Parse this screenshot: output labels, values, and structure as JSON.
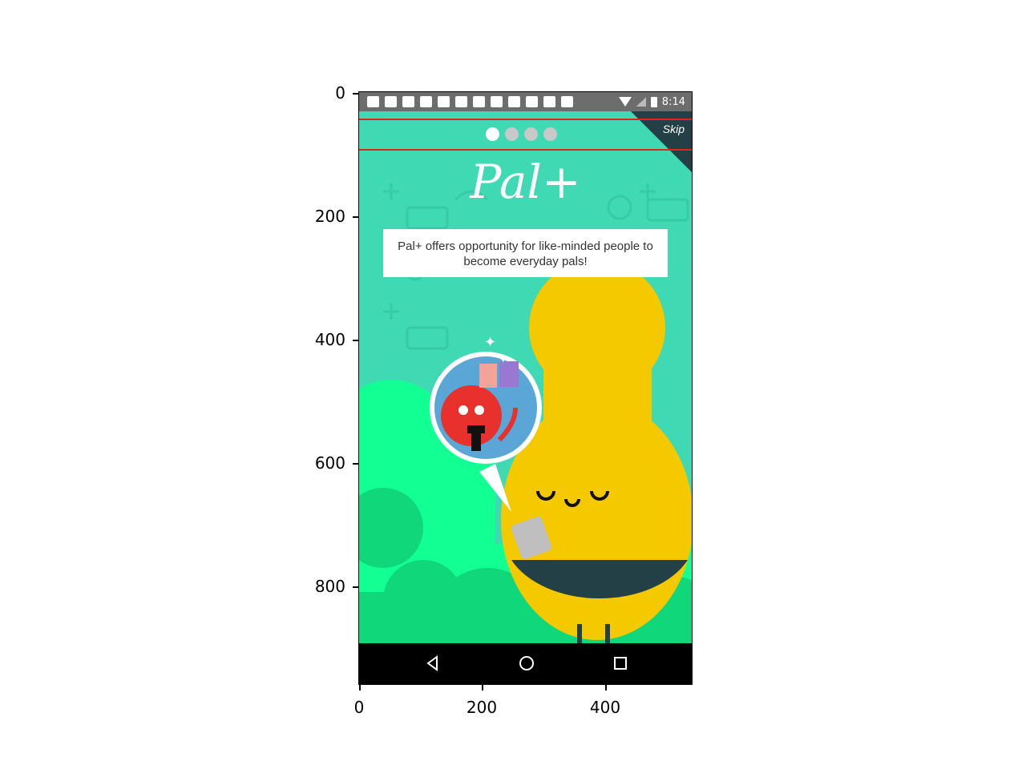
{
  "axes": {
    "y_ticks": [
      "0",
      "200",
      "400",
      "600",
      "800"
    ],
    "x_ticks": [
      "0",
      "200",
      "400"
    ]
  },
  "status_bar": {
    "time": "8:14",
    "icons": [
      "chat-icon",
      "facebook-icon",
      "facebook-icon",
      "facebook-icon",
      "tinder-icon",
      "mail-icon",
      "mask-icon",
      "mask-icon",
      "facebook-icon",
      "globe-icon",
      "messenger-icon",
      "mask-icon",
      "wifi-icon",
      "signal-icon",
      "battery-icon"
    ]
  },
  "onboarding": {
    "skip_label": "Skip",
    "page_dots": 4,
    "active_dot": 0,
    "logo_text": "Pal+",
    "tagline": "Pal+ offers opportunity for like-minded people to become everyday pals!"
  },
  "colors": {
    "background": "#3fd9b3",
    "bush": "#12ff93",
    "bush_dark": "#0fd77a",
    "character": "#f5c900",
    "skip_corner": "#234046",
    "highlight_lines": "#e2231a",
    "nav_bar": "#000000"
  }
}
